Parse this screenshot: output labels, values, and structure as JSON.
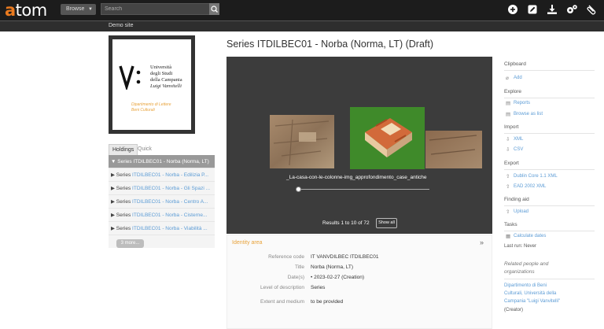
{
  "app": {
    "logo_a": "a",
    "logo_rest": "tom"
  },
  "header": {
    "browse_label": "Browse",
    "search_placeholder": "Search",
    "icons": [
      "add-icon",
      "edit-icon",
      "import-icon",
      "settings-icon",
      "clipboard-icon"
    ]
  },
  "site": {
    "name": "Demo site"
  },
  "institution": {
    "university_lines": [
      "Università",
      "degli Studi",
      "della Campania",
      "Luigi Vanvitelli"
    ],
    "department_lines": [
      "Dipartimento di Lettere",
      "Beni Culturali"
    ]
  },
  "tree_tabs": {
    "holdings": "Holdings",
    "quick_search": "Quick search"
  },
  "tree": {
    "items": [
      {
        "prefix": "▼ Series ",
        "link": "ITDILBEC01 - Norba (Norma, LT)"
      },
      {
        "prefix": "▶ Series ",
        "link": "ITDILBEC01 - Norba - Edilizia P..."
      },
      {
        "prefix": "▶ Series ",
        "link": "ITDILBEC01 - Norba - Gli Spazi ..."
      },
      {
        "prefix": "▶ Series ",
        "link": "ITDILBEC01 - Norba - Centro A..."
      },
      {
        "prefix": "▶ Series ",
        "link": "ITDILBEC01 - Norba - Cisterne..."
      },
      {
        "prefix": "▶ Series ",
        "link": "ITDILBEC01 - Norba - Viabilità ..."
      }
    ],
    "more_label": "3 more..."
  },
  "main": {
    "title": "Series ITDILBEC01 - Norba (Norma, LT) (Draft)",
    "carousel_caption": "_La-casa-con-le-colonne-img_approfondimento_case_antiche",
    "results_text": "Results 1 to 10 of 72",
    "show_all_label": "Show all"
  },
  "identity": {
    "heading": "Identity area",
    "rows": [
      {
        "label": "Reference code",
        "value": "IT VANVDILBEC ITDILBEC01"
      },
      {
        "label": "Title",
        "value": "Norba (Norma, LT)"
      },
      {
        "label": "Date(s)",
        "value": "•  2023-02-27 (Creation)"
      },
      {
        "label": "Level of description",
        "value": "Series"
      },
      {
        "label": "Extent and medium",
        "value": "to be provided"
      }
    ]
  },
  "sidebar": {
    "clipboard": {
      "heading": "Clipboard",
      "add": "Add"
    },
    "explore": {
      "heading": "Explore",
      "reports": "Reports",
      "browse_as_list": "Browse as list"
    },
    "import": {
      "heading": "Import",
      "xml": "XML",
      "csv": "CSV"
    },
    "export": {
      "heading": "Export",
      "dc": "Dublin Core 1.1 XML",
      "ead": "EAD 2002 XML"
    },
    "finding_aid": {
      "heading": "Finding aid",
      "upload": "Upload"
    },
    "tasks": {
      "heading": "Tasks",
      "calculate_dates": "Calculate dates",
      "last_run": "Last run: Never"
    },
    "related": {
      "heading_1": "Related people and",
      "heading_2": "organizations",
      "link_1": "Dipartimento di Beni",
      "link_2": "Culturali, Università della",
      "link_3": "Campania \"Luigi Vanvitelli\"",
      "role": "(Creator)"
    }
  },
  "colors": {
    "accent": "#e97a1f",
    "link": "#5b9bd5",
    "header_bg": "#1c1c1c",
    "identity_heading": "#e8a33c"
  }
}
